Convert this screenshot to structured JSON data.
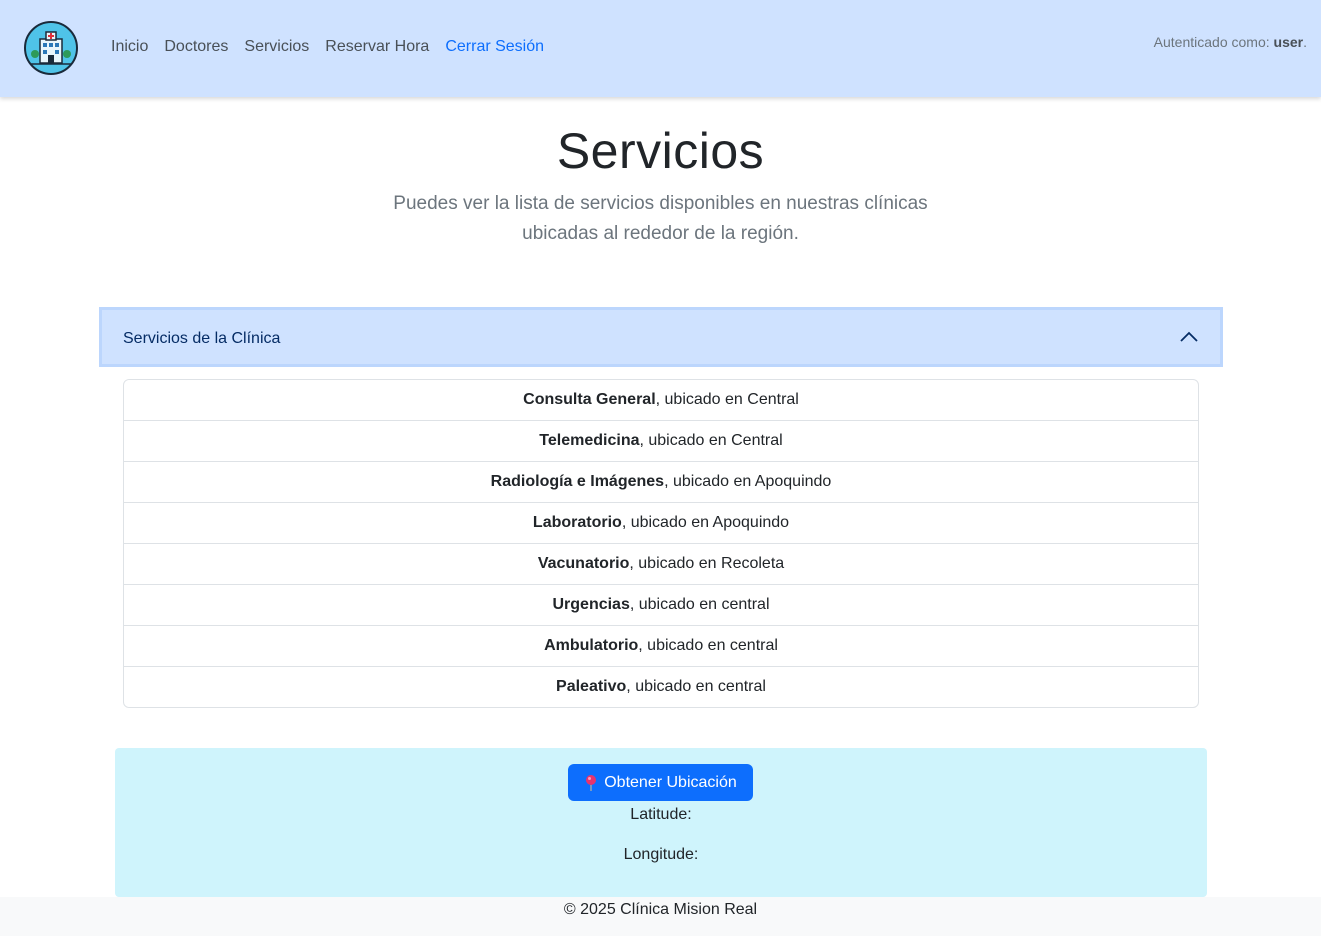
{
  "nav": {
    "links": [
      "Inicio",
      "Doctores",
      "Servicios",
      "Reservar Hora",
      "Cerrar Sesión"
    ],
    "auth_prefix": "Autenticado como:",
    "auth_user": "user",
    "auth_suffix": "."
  },
  "hero": {
    "title": "Servicios",
    "subtitle": "Puedes ver la lista de servicios disponibles en nuestras clínicas ubicadas al rededor de la región."
  },
  "accordion": {
    "title": "Servicios de la Clínica",
    "items": [
      {
        "name": "Consulta General",
        "location": ", ubicado en Central"
      },
      {
        "name": "Telemedicina",
        "location": ", ubicado en Central"
      },
      {
        "name": "Radiología e Imágenes",
        "location": ", ubicado en Apoquindo"
      },
      {
        "name": "Laboratorio",
        "location": ", ubicado en Apoquindo"
      },
      {
        "name": "Vacunatorio",
        "location": ", ubicado en Recoleta"
      },
      {
        "name": "Urgencias",
        "location": ", ubicado en central"
      },
      {
        "name": "Ambulatorio",
        "location": ", ubicado en central"
      },
      {
        "name": "Paleativo",
        "location": ", ubicado en central"
      }
    ]
  },
  "location": {
    "button_label": "Obtener Ubicación",
    "latitude_label": "Latitude:",
    "longitude_label": "Longitude:"
  },
  "footer": {
    "text": "© 2025 Clínica Mision Real"
  },
  "colors": {
    "navbar_bg": "#cfe2ff",
    "accent": "#0d6efd",
    "info_bg": "#cff4fc"
  }
}
